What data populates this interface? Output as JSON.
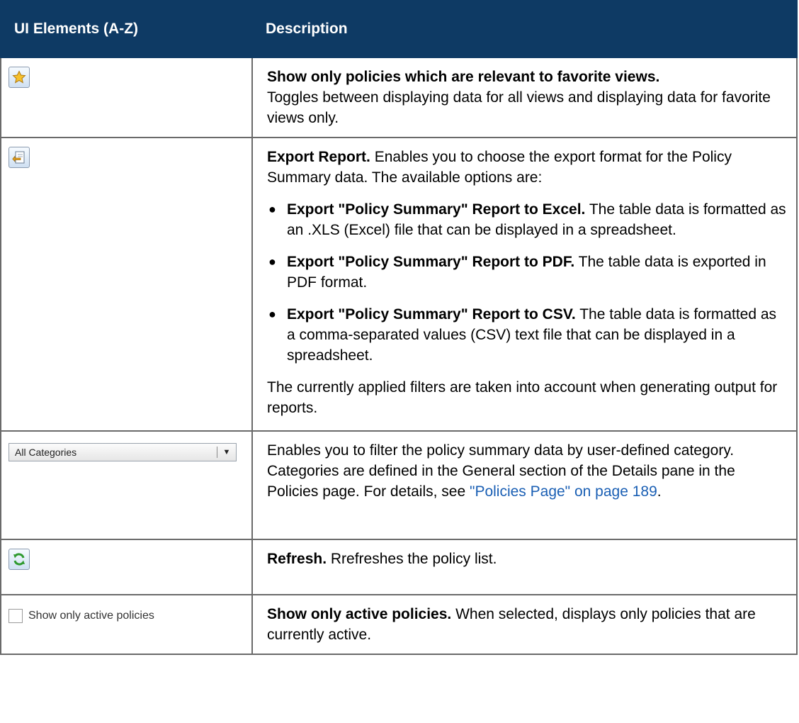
{
  "header": {
    "col1": "UI Elements (A-Z)",
    "col2": "Description"
  },
  "rows": {
    "favorites": {
      "icon": "star-favorite-icon",
      "title": "Show only policies which are relevant to favorite views.",
      "text": "Toggles between displaying data for all views and displaying data for favorite views only."
    },
    "export": {
      "icon": "export-report-icon",
      "title": "Export Report.",
      "text": "Enables you to choose the export format for the Policy Summary data. The available options are:",
      "options": [
        {
          "title": "Export \"Policy Summary\" Report to Excel.",
          "text": "The table data is formatted as an .XLS (Excel) file that can be displayed in a spreadsheet."
        },
        {
          "title": "Export \"Policy Summary\" Report to PDF.",
          "text": "The table data is exported in PDF format."
        },
        {
          "title": "Export \"Policy Summary\" Report to CSV.",
          "text": "The table data is formatted as a comma-separated values (CSV) text file that can be displayed in a spreadsheet."
        }
      ],
      "note": "The currently applied filters are taken into account when generating output for reports."
    },
    "categories": {
      "dropdown_value": "All Categories",
      "text": "Enables you to filter the policy summary data by user-defined category. Categories are defined in the General section of the Details pane in the Policies page. For details, see ",
      "link": "\"Policies Page\" on page 189",
      "suffix": "."
    },
    "refresh": {
      "icon": "refresh-icon",
      "title": "Refresh.",
      "text": "Rrefreshes the policy list."
    },
    "active": {
      "checkbox_label": "Show only active policies",
      "title": "Show only active policies.",
      "text": "When selected, displays only policies that are currently active."
    }
  }
}
